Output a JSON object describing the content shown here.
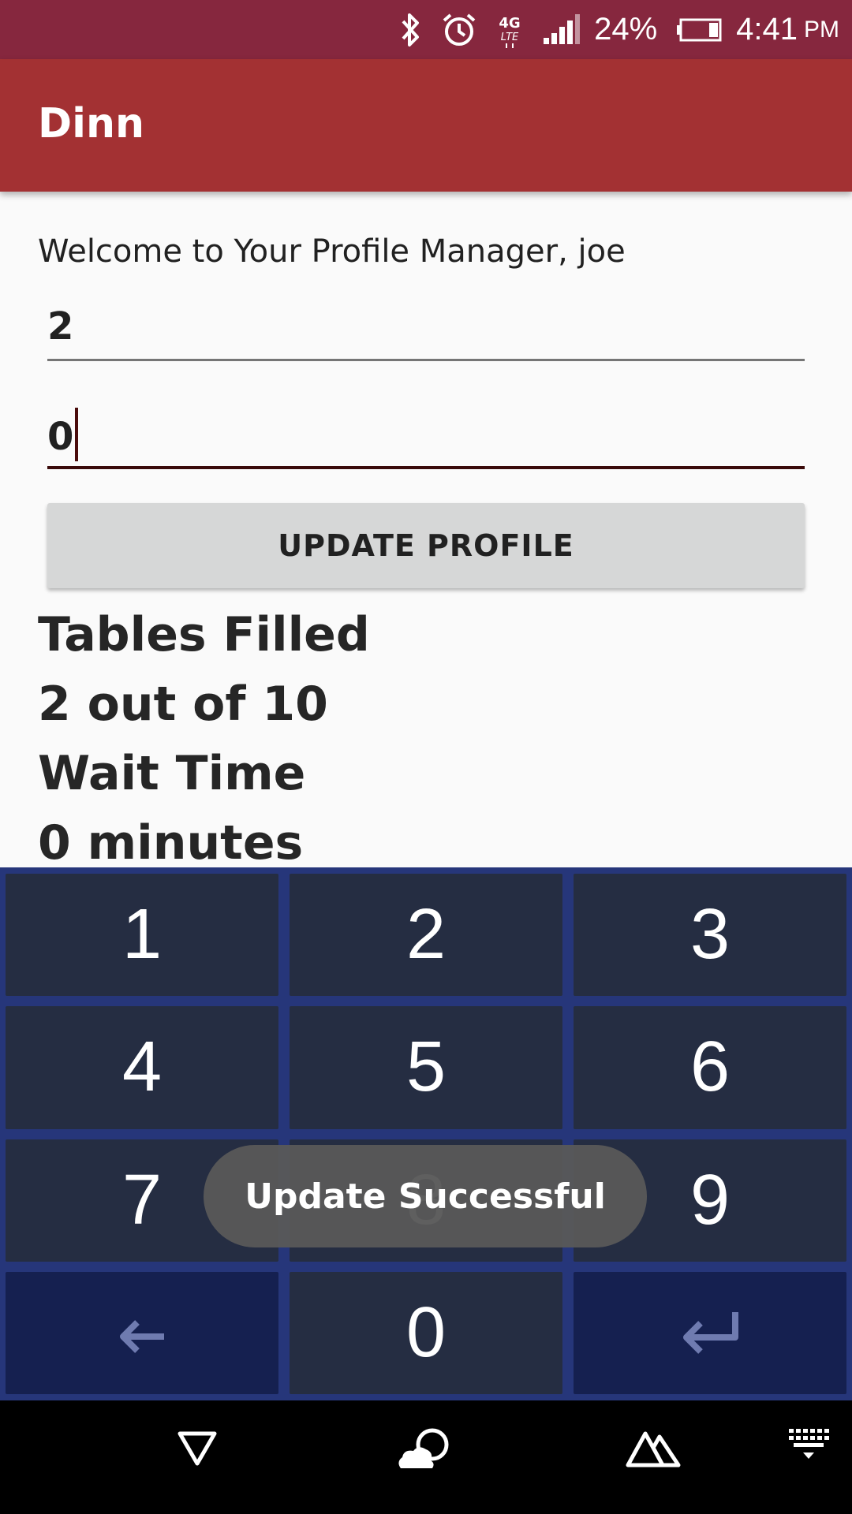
{
  "status_bar": {
    "battery": "24%",
    "time": "4:41",
    "ampm": "PM",
    "network_label": "4G LTE",
    "icons": [
      "bluetooth-icon",
      "alarm-icon",
      "lte-icon",
      "signal-icon",
      "battery-icon"
    ]
  },
  "app_bar": {
    "title": "Dinn",
    "color": "#a33133"
  },
  "profile": {
    "welcome": "Welcome to Your Profile Manager, joe",
    "field_1_value": "2",
    "field_2_value": "0",
    "update_button": "UPDATE PROFILE",
    "tables_filled_label": "Tables Filled",
    "tables_filled_value": "2 out of 10",
    "wait_time_label": "Wait Time",
    "wait_time_value": "0 minutes"
  },
  "keypad": {
    "keys": [
      "1",
      "2",
      "3",
      "4",
      "5",
      "6",
      "7",
      "8",
      "9",
      "0"
    ],
    "backspace_icon": "backspace-arrow-icon",
    "enter_icon": "enter-icon"
  },
  "toast": {
    "message": "Update Successful"
  },
  "nav_bar": {
    "icons": [
      "back-icon",
      "home-cloud-icon",
      "recents-icon",
      "keyboard-icon"
    ]
  },
  "colors": {
    "status_bar": "#86273e",
    "keypad_bg": "#26367a",
    "key_bg": "#252d42"
  }
}
